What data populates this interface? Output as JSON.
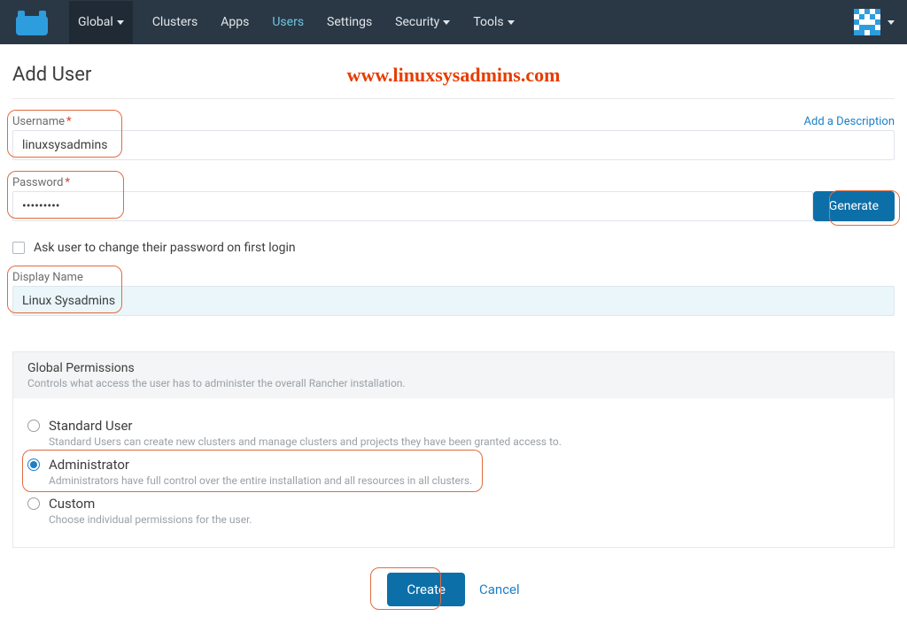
{
  "nav": {
    "global": "Global",
    "items": [
      "Clusters",
      "Apps",
      "Users",
      "Settings",
      "Security",
      "Tools"
    ],
    "active_tab": "Users"
  },
  "page": {
    "title": "Add User",
    "watermark": "www.linuxsysadmins.com"
  },
  "fields": {
    "username_label": "Username",
    "username_value": "linuxsysadmins",
    "add_description": "Add a Description",
    "password_label": "Password",
    "password_value": "•••••••••",
    "generate_label": "Generate",
    "change_pw_label": "Ask user to change their password on first login",
    "display_name_label": "Display Name",
    "display_name_value": "Linux Sysadmins"
  },
  "permissions": {
    "title": "Global Permissions",
    "subtitle": "Controls what access the user has to administer the overall Rancher installation.",
    "options": [
      {
        "label": "Standard User",
        "desc": "Standard Users can create new clusters and manage clusters and projects they have been granted access to.",
        "selected": false
      },
      {
        "label": "Administrator",
        "desc": "Administrators have full control over the entire installation and all resources in all clusters.",
        "selected": true
      },
      {
        "label": "Custom",
        "desc": "Choose individual permissions for the user.",
        "selected": false
      }
    ]
  },
  "actions": {
    "create": "Create",
    "cancel": "Cancel"
  }
}
